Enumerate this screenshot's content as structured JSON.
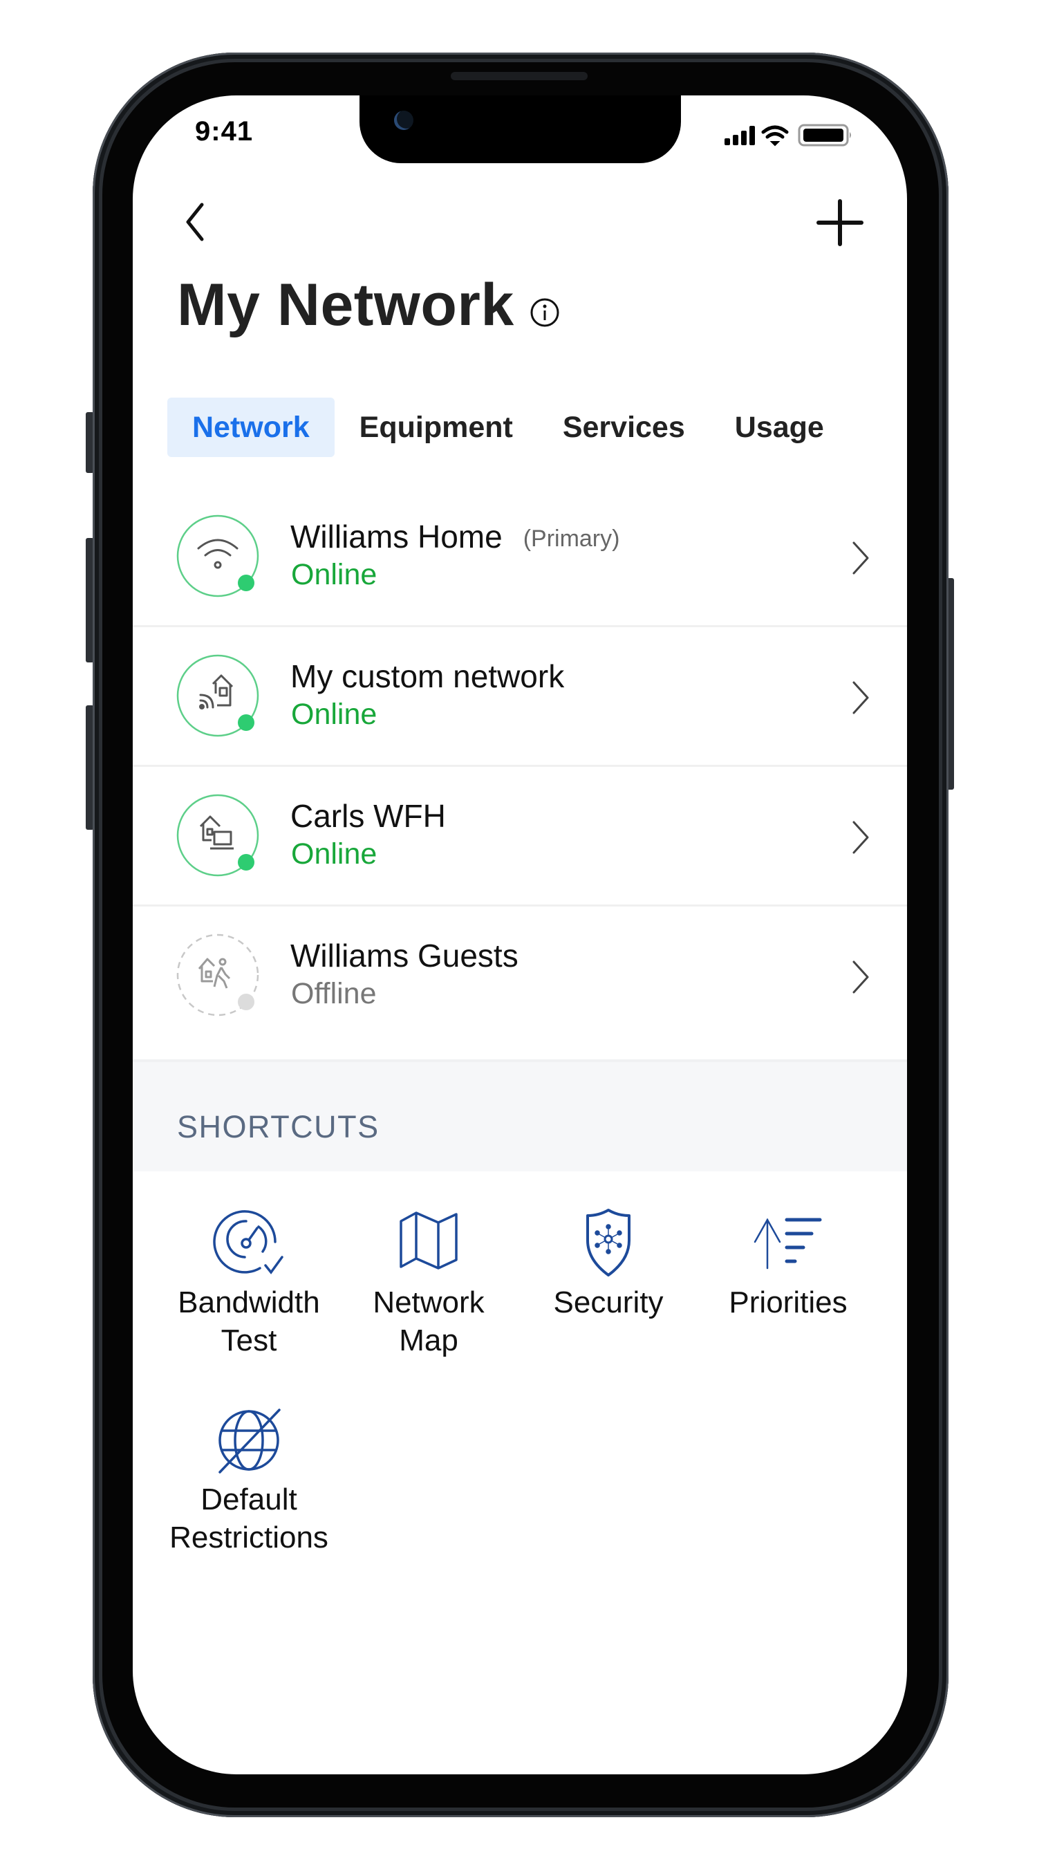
{
  "status_bar": {
    "time": "9:41",
    "icons": [
      "cellular-signal-icon",
      "wifi-icon",
      "battery-icon"
    ]
  },
  "header": {
    "back_icon": "chevron-left-icon",
    "add_icon": "plus-icon",
    "title": "My Network",
    "info_icon": "info-icon"
  },
  "tabs": [
    {
      "label": "Network",
      "active": true
    },
    {
      "label": "Equipment",
      "active": false
    },
    {
      "label": "Services",
      "active": false
    },
    {
      "label": "Usage",
      "active": false
    }
  ],
  "networks": [
    {
      "name": "Williams Home",
      "tag": "(Primary)",
      "status": "Online",
      "icon": "wifi-icon"
    },
    {
      "name": "My custom network",
      "tag": "",
      "status": "Online",
      "icon": "smart-home-icon"
    },
    {
      "name": "Carls WFH",
      "tag": "",
      "status": "Online",
      "icon": "home-office-icon"
    },
    {
      "name": "Williams Guests",
      "tag": "",
      "status": "Offline",
      "icon": "guest-home-icon"
    }
  ],
  "shortcuts": {
    "heading": "SHORTCUTS",
    "items": [
      {
        "label_line1": "Bandwidth",
        "label_line2": "Test",
        "icon": "speedometer-check-icon"
      },
      {
        "label_line1": "Network",
        "label_line2": "Map",
        "icon": "map-icon"
      },
      {
        "label_line1": "Security",
        "label_line2": "",
        "icon": "shield-network-icon"
      },
      {
        "label_line1": "Priorities",
        "label_line2": "",
        "icon": "priority-sort-icon"
      },
      {
        "label_line1": "Default",
        "label_line2": "Restrictions",
        "icon": "globe-blocked-icon"
      }
    ]
  },
  "colors": {
    "accent_blue": "#1a70ea",
    "tab_active_bg": "#e5f0fd",
    "online_green": "#18a73a",
    "status_dot_green": "#2ecc71",
    "offline_gray": "#777777",
    "icon_navy": "#1d4a9a",
    "section_bg": "#f6f7f9",
    "section_text": "#5a6a82"
  }
}
